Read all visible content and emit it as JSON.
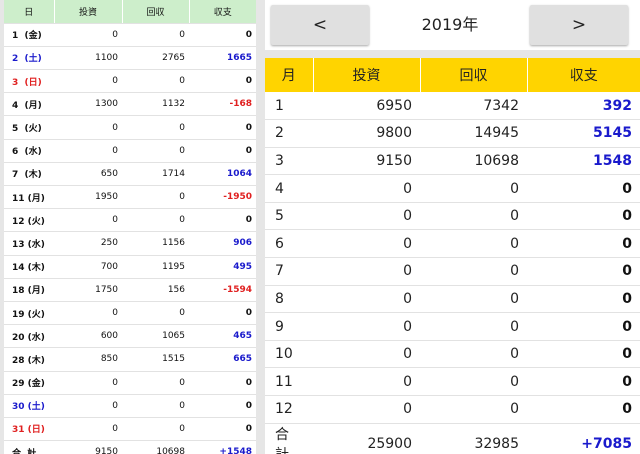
{
  "colors": {
    "positive": "#1a1acc",
    "negative": "#e02020",
    "zero": "#111111",
    "saturday": "#1a1acc",
    "sunday": "#e02020",
    "left_header_bg": "#cdeecb",
    "right_header_bg": "#ffd400"
  },
  "daily": {
    "headers": [
      "日",
      "投資",
      "回収",
      "収支"
    ],
    "rows": [
      {
        "day": "1  (金)",
        "weekday_type": "weekday",
        "investment": "0",
        "return": "0",
        "balance": "0",
        "sign": "zero"
      },
      {
        "day": "2  (土)",
        "weekday_type": "saturday",
        "investment": "1100",
        "return": "2765",
        "balance": "1665",
        "sign": "positive"
      },
      {
        "day": "3  (日)",
        "weekday_type": "sunday",
        "investment": "0",
        "return": "0",
        "balance": "0",
        "sign": "zero"
      },
      {
        "day": "4  (月)",
        "weekday_type": "weekday",
        "investment": "1300",
        "return": "1132",
        "balance": "-168",
        "sign": "negative"
      },
      {
        "day": "5  (火)",
        "weekday_type": "weekday",
        "investment": "0",
        "return": "0",
        "balance": "0",
        "sign": "zero"
      },
      {
        "day": "6  (水)",
        "weekday_type": "weekday",
        "investment": "0",
        "return": "0",
        "balance": "0",
        "sign": "zero"
      },
      {
        "day": "7  (木)",
        "weekday_type": "weekday",
        "investment": "650",
        "return": "1714",
        "balance": "1064",
        "sign": "positive"
      },
      {
        "day": "11 (月)",
        "weekday_type": "weekday",
        "investment": "1950",
        "return": "0",
        "balance": "-1950",
        "sign": "negative"
      },
      {
        "day": "12 (火)",
        "weekday_type": "weekday",
        "investment": "0",
        "return": "0",
        "balance": "0",
        "sign": "zero"
      },
      {
        "day": "13 (水)",
        "weekday_type": "weekday",
        "investment": "250",
        "return": "1156",
        "balance": "906",
        "sign": "positive"
      },
      {
        "day": "14 (木)",
        "weekday_type": "weekday",
        "investment": "700",
        "return": "1195",
        "balance": "495",
        "sign": "positive"
      },
      {
        "day": "18 (月)",
        "weekday_type": "weekday",
        "investment": "1750",
        "return": "156",
        "balance": "-1594",
        "sign": "negative"
      },
      {
        "day": "19 (火)",
        "weekday_type": "weekday",
        "investment": "0",
        "return": "0",
        "balance": "0",
        "sign": "zero"
      },
      {
        "day": "20 (水)",
        "weekday_type": "weekday",
        "investment": "600",
        "return": "1065",
        "balance": "465",
        "sign": "positive"
      },
      {
        "day": "28 (木)",
        "weekday_type": "weekday",
        "investment": "850",
        "return": "1515",
        "balance": "665",
        "sign": "positive"
      },
      {
        "day": "29 (金)",
        "weekday_type": "weekday",
        "investment": "0",
        "return": "0",
        "balance": "0",
        "sign": "zero"
      },
      {
        "day": "30 (土)",
        "weekday_type": "saturday",
        "investment": "0",
        "return": "0",
        "balance": "0",
        "sign": "zero"
      },
      {
        "day": "31 (日)",
        "weekday_type": "sunday",
        "investment": "0",
        "return": "0",
        "balance": "0",
        "sign": "zero"
      }
    ],
    "total": {
      "label": "合  計",
      "investment": "9150",
      "return": "10698",
      "balance": "+1548",
      "sign": "positive"
    }
  },
  "monthly": {
    "nav": {
      "prev_label": "<",
      "next_label": ">",
      "year_label": "2019年"
    },
    "headers": [
      "月",
      "投資",
      "回収",
      "収支"
    ],
    "rows": [
      {
        "month": "1",
        "investment": "6950",
        "return": "7342",
        "balance": "392",
        "sign": "positive"
      },
      {
        "month": "2",
        "investment": "9800",
        "return": "14945",
        "balance": "5145",
        "sign": "positive"
      },
      {
        "month": "3",
        "investment": "9150",
        "return": "10698",
        "balance": "1548",
        "sign": "positive"
      },
      {
        "month": "4",
        "investment": "0",
        "return": "0",
        "balance": "0",
        "sign": "zero"
      },
      {
        "month": "5",
        "investment": "0",
        "return": "0",
        "balance": "0",
        "sign": "zero"
      },
      {
        "month": "6",
        "investment": "0",
        "return": "0",
        "balance": "0",
        "sign": "zero"
      },
      {
        "month": "7",
        "investment": "0",
        "return": "0",
        "balance": "0",
        "sign": "zero"
      },
      {
        "month": "8",
        "investment": "0",
        "return": "0",
        "balance": "0",
        "sign": "zero"
      },
      {
        "month": "9",
        "investment": "0",
        "return": "0",
        "balance": "0",
        "sign": "zero"
      },
      {
        "month": "10",
        "investment": "0",
        "return": "0",
        "balance": "0",
        "sign": "zero"
      },
      {
        "month": "11",
        "investment": "0",
        "return": "0",
        "balance": "0",
        "sign": "zero"
      },
      {
        "month": "12",
        "investment": "0",
        "return": "0",
        "balance": "0",
        "sign": "zero"
      }
    ],
    "total": {
      "label": "合 計",
      "investment": "25900",
      "return": "32985",
      "balance": "+7085",
      "sign": "positive"
    }
  }
}
